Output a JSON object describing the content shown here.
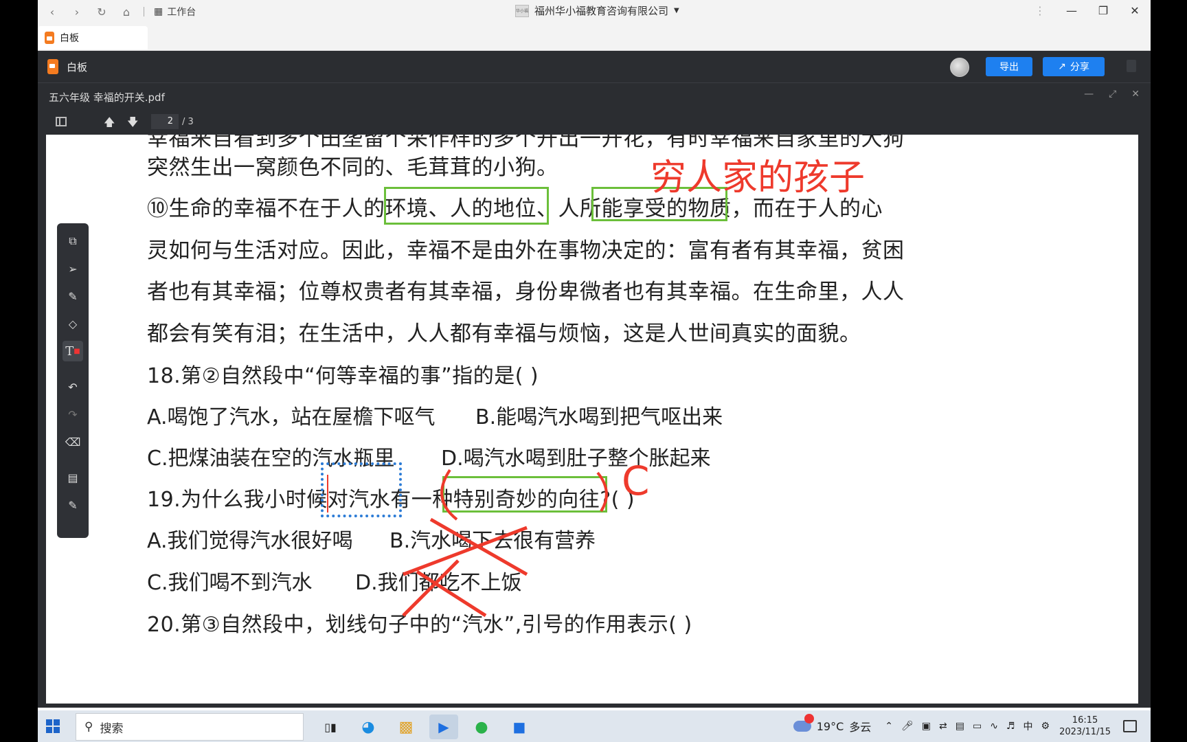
{
  "browser": {
    "workspace_label": "工作台",
    "org_name": "福州华小福教育咨询有限公司",
    "org_logo_text": "华小福",
    "tab_label": "白板"
  },
  "app": {
    "title": "白板",
    "export_label": "导出",
    "share_label": "分享"
  },
  "document": {
    "file_name": "五六年级 幸福的开关.pdf",
    "current_page": "2",
    "total_pages": "/ 3"
  },
  "content": {
    "line_0": "幸福来自看到多个田垄留个采作样的多个开出一开花，有时幸福来自家里的大狗",
    "line_1": "突然生出一窝颜色不同的、毛茸茸的小狗。",
    "line_2": "⑩生命的幸福不在于人的环境、人的地位、人所能享受的物质，而在于人的心",
    "line_3": "灵如何与生活对应。因此，幸福不是由外在事物决定的：富有者有其幸福，贫困",
    "line_4": "者也有其幸福；位尊权贵者有其幸福，身份卑微者也有其幸福。在生命里，人人",
    "line_5": "都会有笑有泪；在生活中，人人都有幸福与烦恼，这是人世间真实的面貌。",
    "q18": "18.第②自然段中“何等幸福的事”指的是(      )",
    "q18_a": "A.喝饱了汽水，站在屋檐下呕气",
    "q18_b": "B.能喝汽水喝到把气呕出来",
    "q18_c": "C.把煤油装在空的汽水瓶里",
    "q18_d": "D.喝汽水喝到肚子整个胀起来",
    "q19": "19.为什么我小时候对汽水有一种特别奇妙的向往?(      )",
    "q19_a": "A.我们觉得汽水很好喝",
    "q19_b": "B.汽水喝下去很有营养",
    "q19_c": "C.我们喝不到汽水",
    "q19_d": "D.我们都吃不上饭",
    "q20": "20.第③自然段中，划线句子中的“汽水”,引号的作用表示(      )"
  },
  "annotations": {
    "handwritten_note": "穷人家的孩子",
    "answer_mark": "C"
  },
  "tools": [
    "insert-page-icon",
    "select-icon",
    "pen-icon",
    "shape-icon",
    "text-icon",
    "undo-icon",
    "redo-icon",
    "eraser-icon",
    "toolbox-icon",
    "edit-icon"
  ],
  "taskbar": {
    "search_label": "搜索",
    "weather_temp": "19°C",
    "weather_desc": "多云",
    "ime_label": "中",
    "time": "16:15",
    "date": "2023/11/15"
  },
  "colors": {
    "accent_blue": "#1e80f0",
    "annotation_red": "#ee3a2c",
    "highlight_green": "#6bbf3a",
    "selection_blue": "#2d7cd6",
    "dark_chrome": "#2b2d31"
  }
}
